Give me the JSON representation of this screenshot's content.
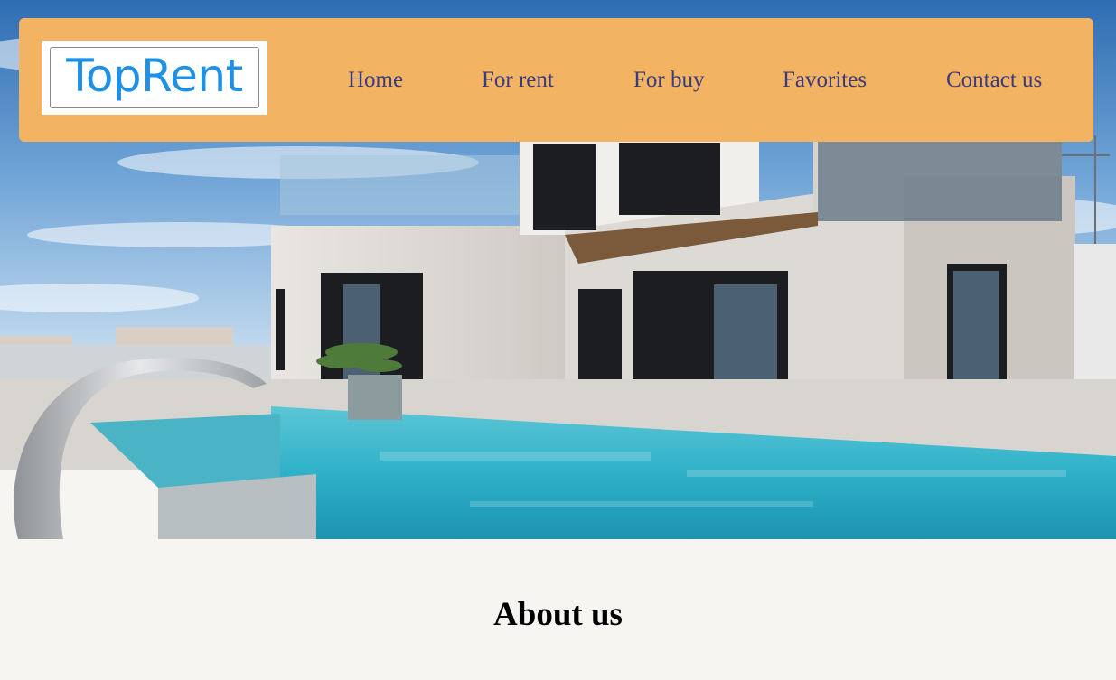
{
  "brand": {
    "logo_text": "TopRent",
    "logo_color": "#1e90e6"
  },
  "nav": {
    "background": "#f2b462",
    "link_color": "#3a3a7e",
    "items": [
      {
        "label": "Home"
      },
      {
        "label": "For rent"
      },
      {
        "label": "For buy"
      },
      {
        "label": "Favorites"
      },
      {
        "label": "Contact us"
      }
    ]
  },
  "hero": {
    "image": "modern-villa-with-swimming-pool"
  },
  "about": {
    "title": "About us"
  }
}
